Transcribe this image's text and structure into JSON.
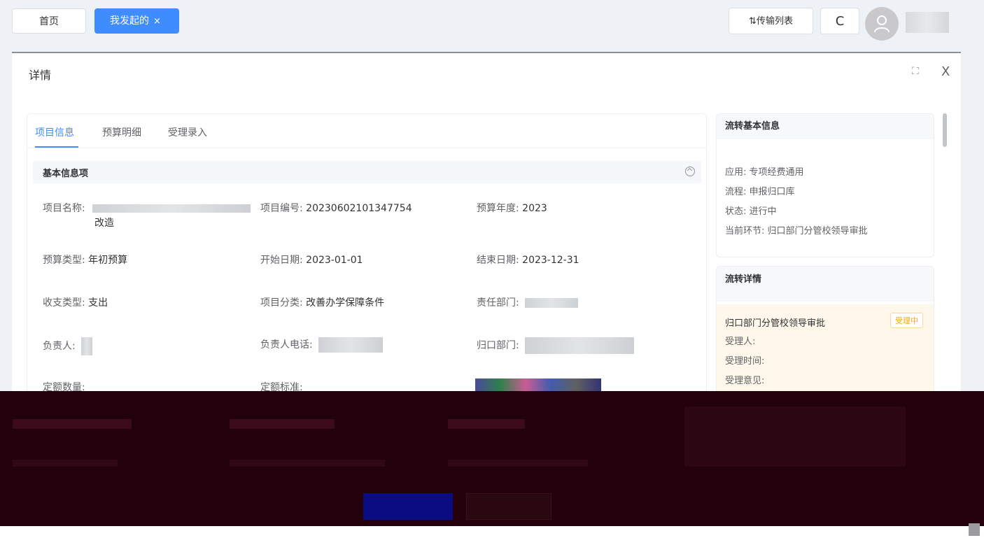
{
  "topbar": {
    "tab_home": "首页",
    "tab_active": "我发起的",
    "tab_close": "×",
    "transfer_label": "⇅传输列表",
    "refresh_label": "C"
  },
  "dialog": {
    "title": "详情",
    "maximize": "⛶",
    "close": "X"
  },
  "tabs": [
    {
      "label": "项目信息",
      "active": true
    },
    {
      "label": "预算明细",
      "active": false
    },
    {
      "label": "受理录入",
      "active": false
    }
  ],
  "section": {
    "title": "基本信息项"
  },
  "fields": {
    "project_name_label": "项目名称:",
    "project_name_suffix": "改造",
    "project_no_label": "项目编号:",
    "project_no_value": "20230602101347754",
    "budget_year_label": "预算年度:",
    "budget_year_value": "2023",
    "budget_type_label": "预算类型:",
    "budget_type_value": "年初预算",
    "start_date_label": "开始日期:",
    "start_date_value": "2023-01-01",
    "end_date_label": "结束日期:",
    "end_date_value": "2023-12-31",
    "income_type_label": "收支类型:",
    "income_type_value": "支出",
    "category_label": "项目分类:",
    "category_value": "改善办学保障条件",
    "dept_label": "责任部门:",
    "owner_label": "负责人:",
    "owner_phone_label": "负责人电话:",
    "return_dept_label": "归口部门:",
    "quota_qty_label": "定额数量:",
    "quota_std_label": "定额标准:"
  },
  "flow_basic": {
    "title": "流转基本信息",
    "app": "应用:  专项经费通用",
    "process": "流程:  申报归口库",
    "status": "状态:  进行中",
    "current": "当前环节:  归口部门分管校领导审批"
  },
  "flow_detail": {
    "title": "流转详情",
    "step": "归口部门分管校领导审批",
    "badge": "受理中",
    "handler": "受理人:",
    "time": "受理时间:",
    "opinion": "受理意见:"
  },
  "colors": {
    "accent": "#3f8cff",
    "badge": "#f5a623",
    "glitch_bg": "#22000c"
  }
}
